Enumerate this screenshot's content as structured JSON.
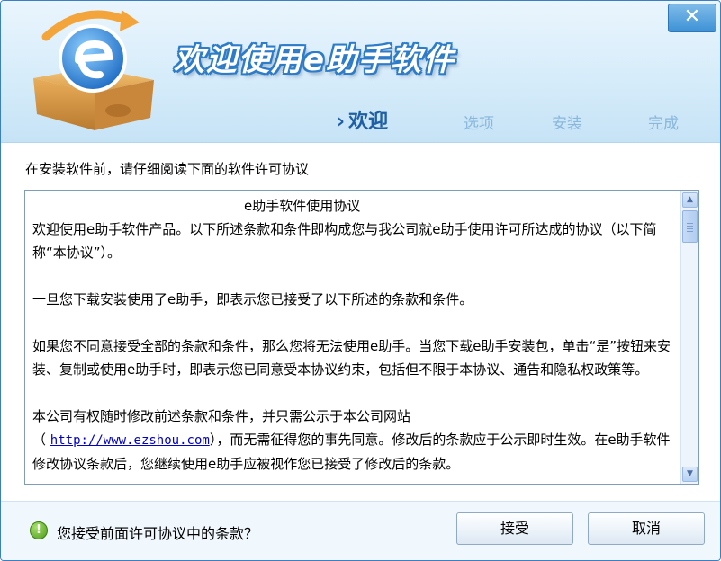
{
  "window": {
    "title": "欢迎使用e助手软件",
    "close_glyph": "✕"
  },
  "steps": {
    "arrow": "›",
    "items": [
      "欢迎",
      "选项",
      "安装",
      "完成"
    ],
    "active_index": 0
  },
  "intro": "在安装软件前，请仔细阅读下面的软件许可协议",
  "license": {
    "doc_title": "e助手软件使用协议",
    "p1": "欢迎使用e助手软件产品。以下所述条款和条件即构成您与我公司就e助手使用许可所达成的协议（以下简称“本协议”）。",
    "p2": "一旦您下载安装使用了e助手，即表示您已接受了以下所述的条款和条件。",
    "p3": "如果您不同意接受全部的条款和条件，那么您将无法使用e助手。当您下载e助手安装包，单击“是”按钮来安装、复制或使用e助手时，即表示您已同意受本协议约束，包括但不限于本协议、通告和隐私权政策等。",
    "p4_a": "本公司有权随时修改前述条款和条件，并只需公示于本公司网站",
    "p4_open": "（",
    "p4_link": "http://www.ezshou.com",
    "p4_b": "），而无需征得您的事先同意。修改后的条款应于公示即时生效。在e助手软件修改协议条款后，您继续使用e助手应被视作您已接受了修改后的条款。"
  },
  "footer": {
    "question_icon_glyph": "!",
    "question": "您接受前面许可协议中的条款？",
    "accept_label": "接受",
    "cancel_label": "取消"
  },
  "colors": {
    "title_outline": "#2d7cc9",
    "step_active": "#1e5fa6",
    "step_inactive": "#8ab7dc",
    "link": "#0000cc"
  }
}
